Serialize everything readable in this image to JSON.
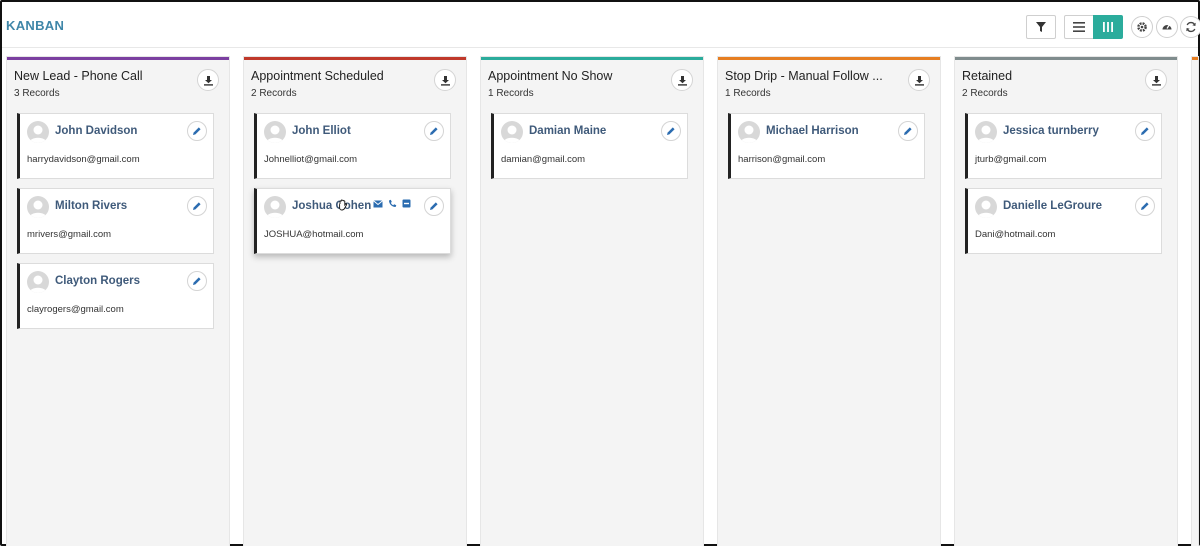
{
  "app": {
    "title": "KANBAN"
  },
  "toolbar": {
    "icons": [
      "filter-icon",
      "list-view-icon",
      "board-view-icon",
      "gear-icon",
      "dashboard-icon",
      "refresh-icon"
    ],
    "accent_color": "#2bac9c",
    "title_color": "#3f86a8"
  },
  "columns": [
    {
      "title": "New Lead - Phone Call",
      "count": "3 Records",
      "color": "#7b3fa0",
      "cards": [
        {
          "name": "John Davidson",
          "email": "harrydavidson@gmail.com"
        },
        {
          "name": "Milton Rivers",
          "email": "mrivers@gmail.com"
        },
        {
          "name": "Clayton Rogers",
          "email": "clayrogers@gmail.com"
        }
      ]
    },
    {
      "title": "Appointment Scheduled",
      "count": "2 Records",
      "color": "#c0392b",
      "cards": [
        {
          "name": "John Elliot",
          "email": "Johnelliot@gmail.com"
        },
        {
          "name": "Joshua Cohen",
          "email": "JOSHUA@hotmail.com"
        }
      ]
    },
    {
      "title": "Appointment No Show",
      "count": "1 Records",
      "color": "#2bac9c",
      "cards": [
        {
          "name": "Damian Maine",
          "email": "damian@gmail.com"
        }
      ]
    },
    {
      "title": "Stop Drip - Manual Follow ...",
      "count": "1 Records",
      "color": "#e67e22",
      "cards": [
        {
          "name": "Michael Harrison",
          "email": "harrison@gmail.com"
        }
      ]
    },
    {
      "title": "Retained",
      "count": "2 Records",
      "color": "#7f8c8d",
      "cards": [
        {
          "name": "Jessica turnberry",
          "email": "jturb@gmail.com"
        },
        {
          "name": "Danielle LeGroure",
          "email": "Dani@hotmail.com"
        }
      ]
    }
  ],
  "partial_column": {
    "color": "#e67e22"
  }
}
